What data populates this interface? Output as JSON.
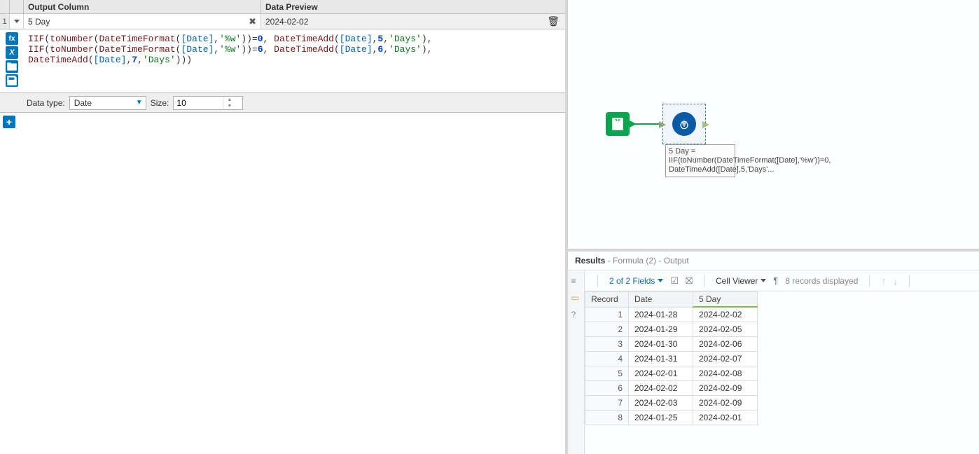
{
  "config": {
    "header_output_column": "Output Column",
    "header_data_preview": "Data Preview",
    "row_number": "1",
    "output_column_value": "5 Day",
    "data_preview_value": "2024-02-02",
    "data_type_label": "Data type:",
    "data_type_value": "Date",
    "size_label": "Size:",
    "size_value": "10"
  },
  "formula": {
    "l1_a": "IIF",
    "l1_b": "(",
    "l1_c": "toNumber",
    "l1_d": "(",
    "l1_e": "DateTimeFormat",
    "l1_f": "(",
    "l1_g": "[Date]",
    "l1_h": ",",
    "l1_i": "'%w'",
    "l1_j": "))=",
    "l1_k": "0",
    "l1_l": ", ",
    "l1_m": "DateTimeAdd",
    "l1_n": "(",
    "l1_o": "[Date]",
    "l1_p": ",",
    "l1_q": "5",
    "l1_r": ",",
    "l1_s": "'Days'",
    "l1_t": "),",
    "l2_a": "IIF",
    "l2_b": "(",
    "l2_c": "toNumber",
    "l2_d": "(",
    "l2_e": "DateTimeFormat",
    "l2_f": "(",
    "l2_g": "[Date]",
    "l2_h": ",",
    "l2_i": "'%w'",
    "l2_j": "))=",
    "l2_k": "6",
    "l2_l": ", ",
    "l2_m": "DateTimeAdd",
    "l2_n": "(",
    "l2_o": "[Date]",
    "l2_p": ",",
    "l2_q": "6",
    "l2_r": ",",
    "l2_s": "'Days'",
    "l2_t": "),",
    "l3_a": "DateTimeAdd",
    "l3_b": "(",
    "l3_c": "[Date]",
    "l3_d": ",",
    "l3_e": "7",
    "l3_f": ",",
    "l3_g": "'Days'",
    "l3_h": ")))"
  },
  "canvas": {
    "annotation": "5 Day = IIF(toNumber(DateTimeFormat([Date],'%w'))=0, DateTimeAdd([Date],5,'Days'..."
  },
  "results": {
    "title_bold": "Results",
    "title_rest": " - Formula (2) - Output",
    "fields_link": "2 of 2 Fields",
    "cell_viewer": "Cell Viewer",
    "records_displayed": "8 records displayed",
    "col_record": "Record",
    "col_date": "Date",
    "col_5day": "5 Day",
    "rows": [
      {
        "n": "1",
        "date": "2024-01-28",
        "d5": "2024-02-02"
      },
      {
        "n": "2",
        "date": "2024-01-29",
        "d5": "2024-02-05"
      },
      {
        "n": "3",
        "date": "2024-01-30",
        "d5": "2024-02-06"
      },
      {
        "n": "4",
        "date": "2024-01-31",
        "d5": "2024-02-07"
      },
      {
        "n": "5",
        "date": "2024-02-01",
        "d5": "2024-02-08"
      },
      {
        "n": "6",
        "date": "2024-02-02",
        "d5": "2024-02-09"
      },
      {
        "n": "7",
        "date": "2024-02-03",
        "d5": "2024-02-09"
      },
      {
        "n": "8",
        "date": "2024-01-25",
        "d5": "2024-02-01"
      }
    ]
  }
}
